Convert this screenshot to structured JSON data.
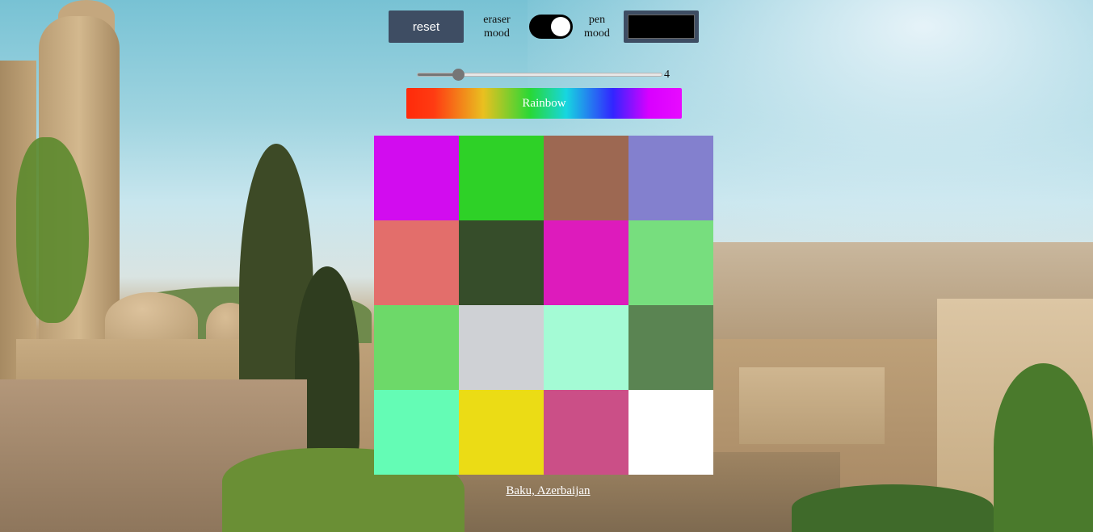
{
  "toolbar": {
    "reset_label": "reset",
    "eraser_label": "eraser mood",
    "pen_label": "pen mood",
    "toggle_state": "pen",
    "pen_color": "#000000"
  },
  "brush_size": {
    "value": "4",
    "min": 1,
    "max": 64
  },
  "rainbow_label": "Rainbow",
  "grid": {
    "rows": 4,
    "cols": 4,
    "cells": [
      "#d20cef",
      "#2ed127",
      "#9d6852",
      "#8380ce",
      "#e36e6b",
      "#364d2a",
      "#dd1bbc",
      "#77de7e",
      "#6dd969",
      "#cfd1d5",
      "#a4fbd5",
      "#5a8452",
      "#64fcb5",
      "#ebdc15",
      "#cb4f87",
      "#ffffff"
    ]
  },
  "caption": "Baku, Azerbaijan"
}
